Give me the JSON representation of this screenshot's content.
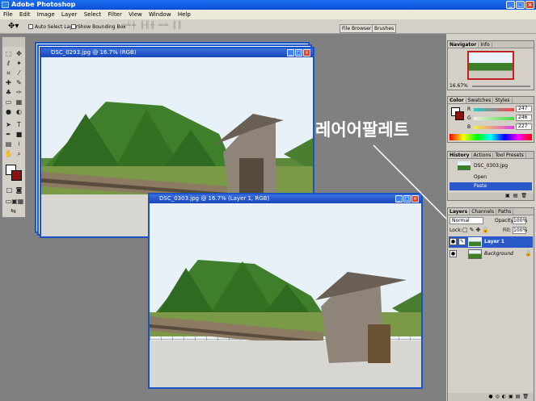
{
  "app": {
    "title": "Adobe Photoshop"
  },
  "menu": [
    "File",
    "Edit",
    "Image",
    "Layer",
    "Select",
    "Filter",
    "View",
    "Window",
    "Help"
  ],
  "options": {
    "auto_select": "Auto Select Layer",
    "bounding_box": "Show Bounding Box",
    "file_browser": "File Browser",
    "brushes": "Brushes"
  },
  "doc_back": {
    "title": "DSC_0293.jpg @ 16.7% (RGB)"
  },
  "doc_front": {
    "title": "DSC_0303.jpg @ 16.7% (Layer 1, RGB)"
  },
  "annotation": "레어어팔레트",
  "navigator": {
    "tabs": [
      "Navigator",
      "Info"
    ],
    "zoom": "16.67%"
  },
  "color": {
    "tabs": [
      "Color",
      "Swatches",
      "Styles"
    ],
    "r_label": "R",
    "r": "247",
    "g_label": "G",
    "g": "246",
    "b_label": "B",
    "b": "227"
  },
  "history": {
    "tabs": [
      "History",
      "Actions",
      "Tool Presets"
    ],
    "snapshot": "DSC_0303.jpg",
    "items": [
      "Open",
      "Paste"
    ]
  },
  "layers": {
    "tabs": [
      "Layers",
      "Channels",
      "Paths"
    ],
    "mode": "Normal",
    "opacity_label": "Opacity:",
    "opacity": "100%",
    "lock_label": "Lock:",
    "fill_label": "Fill:",
    "fill": "100%",
    "items": [
      "Layer 1",
      "Background"
    ]
  },
  "colors": {
    "title_blue": "#0a4fd8",
    "selection": "#2a58c8",
    "window_border": "#1a52c8"
  }
}
